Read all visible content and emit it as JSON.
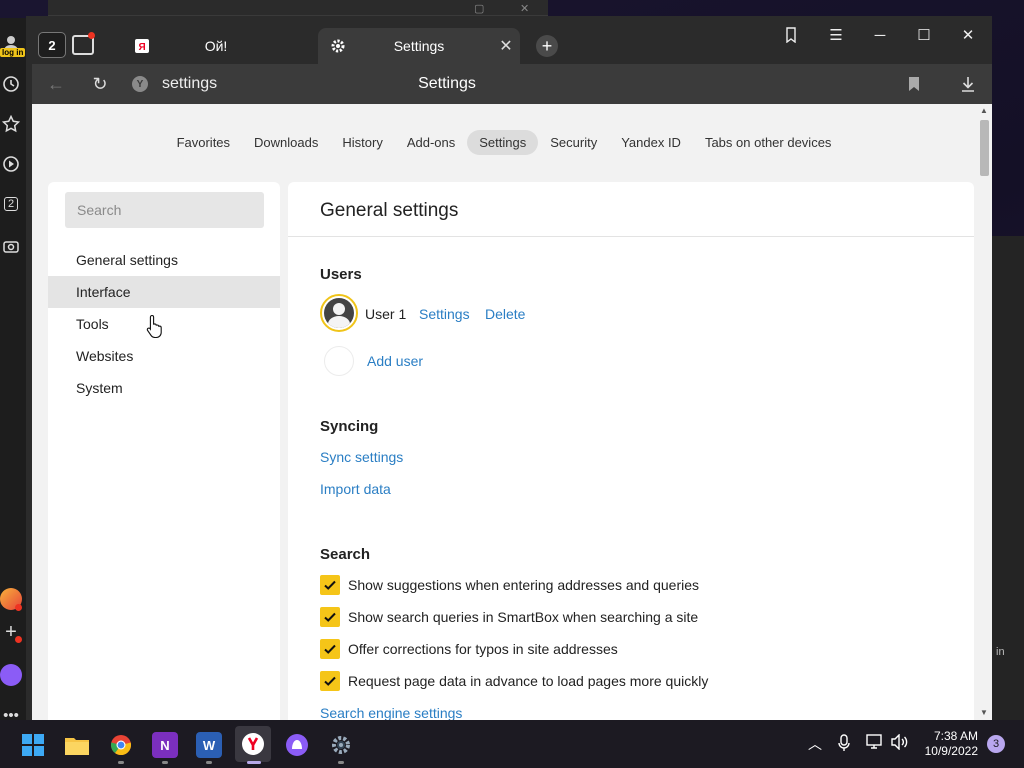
{
  "browser": {
    "tab_count": "2",
    "tabs": [
      {
        "title": "Ой!",
        "favicon": "yandex-icon"
      },
      {
        "title": "Settings",
        "favicon": "gear-icon"
      }
    ],
    "sidebar_login_badge": "log in",
    "sidebar_counter": "2"
  },
  "toolbar": {
    "address": "settings",
    "page_title": "Settings"
  },
  "topnav": {
    "items": [
      "Favorites",
      "Downloads",
      "History",
      "Add-ons",
      "Settings",
      "Security",
      "Yandex ID",
      "Tabs on other devices"
    ],
    "active": "Settings"
  },
  "left_nav": {
    "search_placeholder": "Search",
    "items": [
      "General settings",
      "Interface",
      "Tools",
      "Websites",
      "System"
    ],
    "hovered": "Interface"
  },
  "main": {
    "title": "General settings",
    "users": {
      "heading": "Users",
      "user_name": "User 1",
      "settings_link": "Settings",
      "delete_link": "Delete",
      "add_user_link": "Add user"
    },
    "syncing": {
      "heading": "Syncing",
      "sync_link": "Sync settings",
      "import_link": "Import data"
    },
    "search": {
      "heading": "Search",
      "options": [
        {
          "label": "Show suggestions when entering addresses and queries",
          "checked": true
        },
        {
          "label": "Show search queries in SmartBox when searching a site",
          "checked": true
        },
        {
          "label": "Offer corrections for typos in site addresses",
          "checked": true
        },
        {
          "label": "Request page data in advance to load pages more quickly",
          "checked": true
        }
      ],
      "engine_link": "Search engine settings"
    }
  },
  "taskbar": {
    "time": "7:38 AM",
    "date": "10/9/2022",
    "notification_count": "3",
    "side_peek_text": "in"
  },
  "colors": {
    "accent_yellow": "#f5c518",
    "link_blue": "#2a7ec4"
  }
}
